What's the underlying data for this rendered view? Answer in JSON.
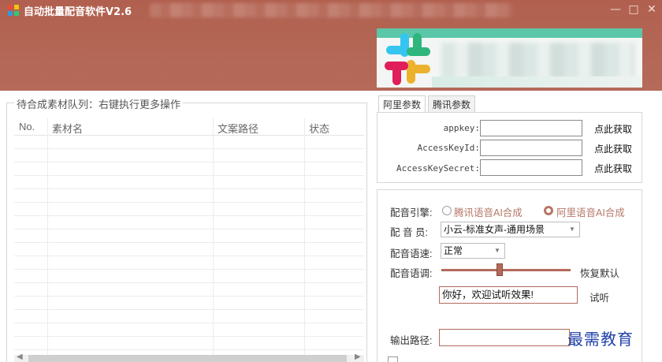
{
  "window": {
    "title": "自动批量配音软件V2.6",
    "controls": {
      "minimize": "—",
      "maximize": "□",
      "close": "✕"
    }
  },
  "queue": {
    "legend": "待合成素材队列：右键执行更多操作",
    "columns": [
      "No.",
      "素材名",
      "文案路径",
      "状态"
    ],
    "rows": []
  },
  "tabs": [
    {
      "label": "阿里参数",
      "active": true
    },
    {
      "label": "腾讯参数",
      "active": false
    }
  ],
  "aliyun": {
    "appkey_label": "appkey:",
    "access_key_id_label": "AccessKeyId:",
    "access_key_secret_label": "AccessKeySecret:",
    "appkey_value": "",
    "access_key_id_value": "",
    "access_key_secret_value": "",
    "get_link": "点此获取"
  },
  "dubbing": {
    "engine_label": "配音引擎:",
    "engine_options": [
      "腾讯语音AI合成",
      "阿里语音AI合成"
    ],
    "engine_selected": "阿里语音AI合成",
    "voice_label": "配 音 员:",
    "voice_value": "小云-标准女声-通用场景",
    "speed_label": "配音语速:",
    "speed_value": "正常",
    "pitch_label": "配音语调:",
    "pitch_level": 0.45,
    "reset_label": "恢复默认",
    "preview_text": "你好，欢迎试听效果!",
    "preview_button": "试听",
    "output_label": "输出路径:",
    "output_value": ""
  },
  "watermark": "最需教育",
  "colors": {
    "header": "#b1604f",
    "accent": "#b57767",
    "slider": "#b46a5a"
  }
}
